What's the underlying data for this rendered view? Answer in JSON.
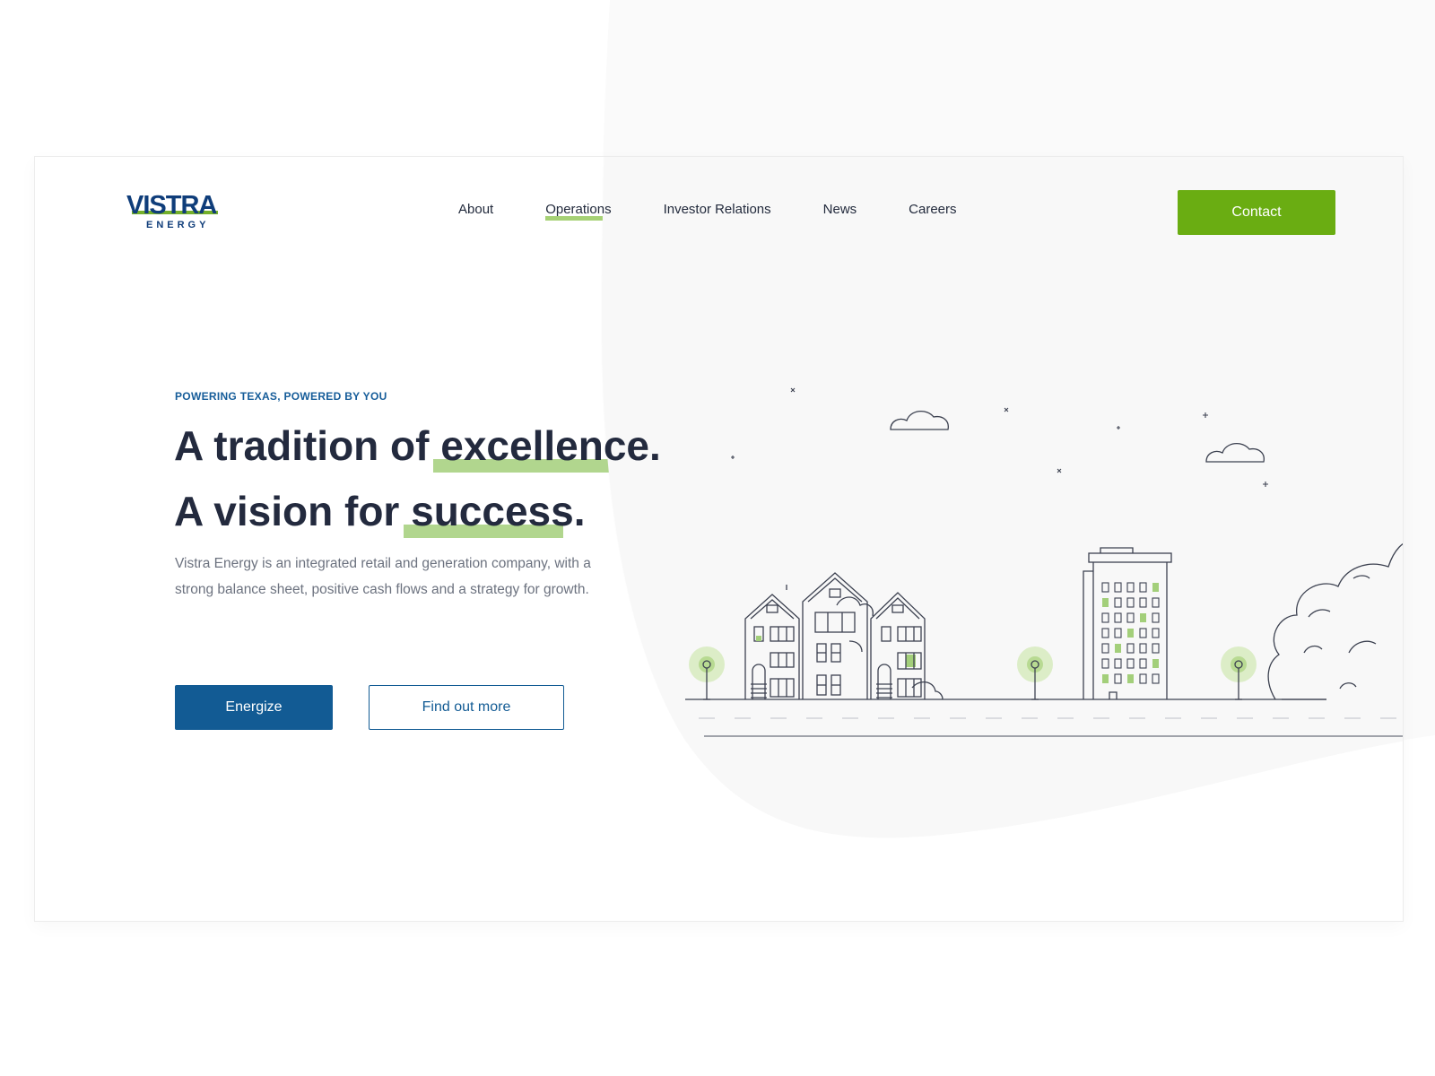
{
  "brand": {
    "name": "VISTRA",
    "tagline": "ENERGY"
  },
  "nav": {
    "items": [
      {
        "label": "About",
        "active": false
      },
      {
        "label": "Operations",
        "active": true
      },
      {
        "label": "Investor Relations",
        "active": false
      },
      {
        "label": "News",
        "active": false
      },
      {
        "label": "Careers",
        "active": false
      }
    ],
    "contact_label": "Contact"
  },
  "hero": {
    "eyebrow": "POWERING TEXAS, POWERED BY YOU",
    "line1_prefix": "A tradition of ",
    "line1_highlight": "excellence",
    "line1_suffix": ".",
    "line2_prefix": "A vision for ",
    "line2_highlight": "success",
    "line2_suffix": ".",
    "description": "Vistra Energy is an integrated retail and generation company, with a strong balance sheet, positive cash flows and a strategy for growth.",
    "primary_button": "Energize",
    "secondary_button": "Find out more"
  },
  "colors": {
    "brand_blue": "#125b94",
    "brand_green": "#6aad12",
    "highlight_green": "#a3cf7a",
    "heading": "#232a3e",
    "text_muted": "#6c727f"
  }
}
